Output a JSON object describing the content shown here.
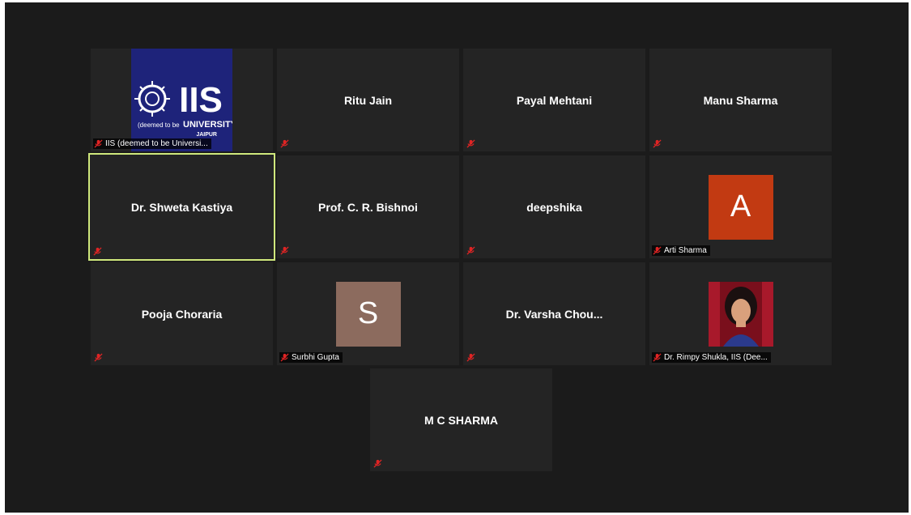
{
  "participants": [
    {
      "label": "IIS (deemed to be Universi..."
    },
    {
      "name": "Ritu Jain"
    },
    {
      "name": "Payal Mehtani"
    },
    {
      "name": "Manu Sharma"
    },
    {
      "name": "Dr. Shweta Kastiya",
      "active_speaker": true
    },
    {
      "name": "Prof. C. R. Bishnoi"
    },
    {
      "name": "deepshika"
    },
    {
      "avatar_letter": "A",
      "avatar_color": "#c23a12",
      "label": "Arti Sharma"
    },
    {
      "name": "Pooja Choraria"
    },
    {
      "avatar_letter": "S",
      "avatar_color": "#8c6b5e",
      "label": "Surbhi Gupta"
    },
    {
      "name": "Dr. Varsha Chou..."
    },
    {
      "label": "Dr. Rimpy Shukla, IIS (Dee..."
    },
    {
      "name": "M C SHARMA"
    }
  ],
  "logo": {
    "title": "IIS",
    "line1": "(deemed to be",
    "line2": "UNIVERSITY)",
    "line3": "JAIPUR"
  },
  "colors": {
    "active_border": "#cfe87c",
    "mute_icon": "#e02424",
    "tile_bg": "#242424",
    "app_bg": "#1b1b1b"
  },
  "icons": {
    "mute": "microphone-muted-icon"
  }
}
